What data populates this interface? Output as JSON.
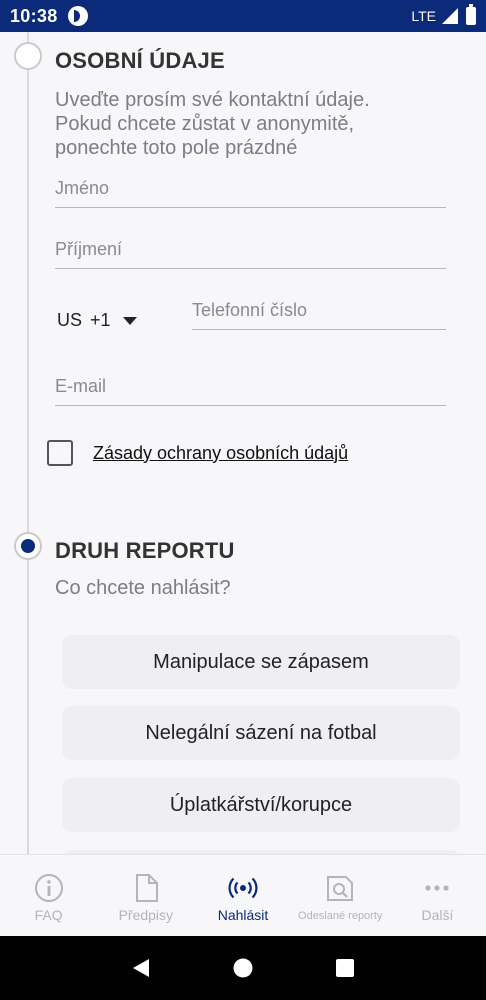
{
  "status": {
    "time": "10:38",
    "network": "LTE"
  },
  "personal": {
    "title": "OSOBNÍ ÚDAJE",
    "desc_lines": [
      "Uveďte prosím své kontaktní údaje.",
      "Pokud chcete zůstat v anonymitě,",
      "ponechte toto pole prázdné"
    ],
    "first_name_placeholder": "Jméno",
    "last_name_placeholder": "Příjmení",
    "country_code": "US",
    "dial_code": "+1",
    "phone_placeholder": "Telefonní číslo",
    "email_placeholder": "E-mail",
    "privacy_label": "Zásady ochrany osobních údajů",
    "privacy_checked": false
  },
  "report_type": {
    "title": "DRUH REPORTU",
    "question": "Co chcete nahlásit?",
    "options": [
      "Manipulace se zápasem",
      "Nelegální sázení na fotbal",
      "Úplatkářství/korupce"
    ]
  },
  "bottom_nav": {
    "items": [
      {
        "label": "FAQ",
        "icon": "info-icon"
      },
      {
        "label": "Předpisy",
        "icon": "document-icon"
      },
      {
        "label": "Nahlásit",
        "icon": "broadcast-icon",
        "active": true
      },
      {
        "label": "Odeslané reporty",
        "icon": "search-document-icon"
      },
      {
        "label": "Další",
        "icon": "more-icon"
      }
    ]
  },
  "colors": {
    "primary": "#0b2a7a",
    "background": "#f7f7f9",
    "inactive": "#b4b4ba"
  }
}
